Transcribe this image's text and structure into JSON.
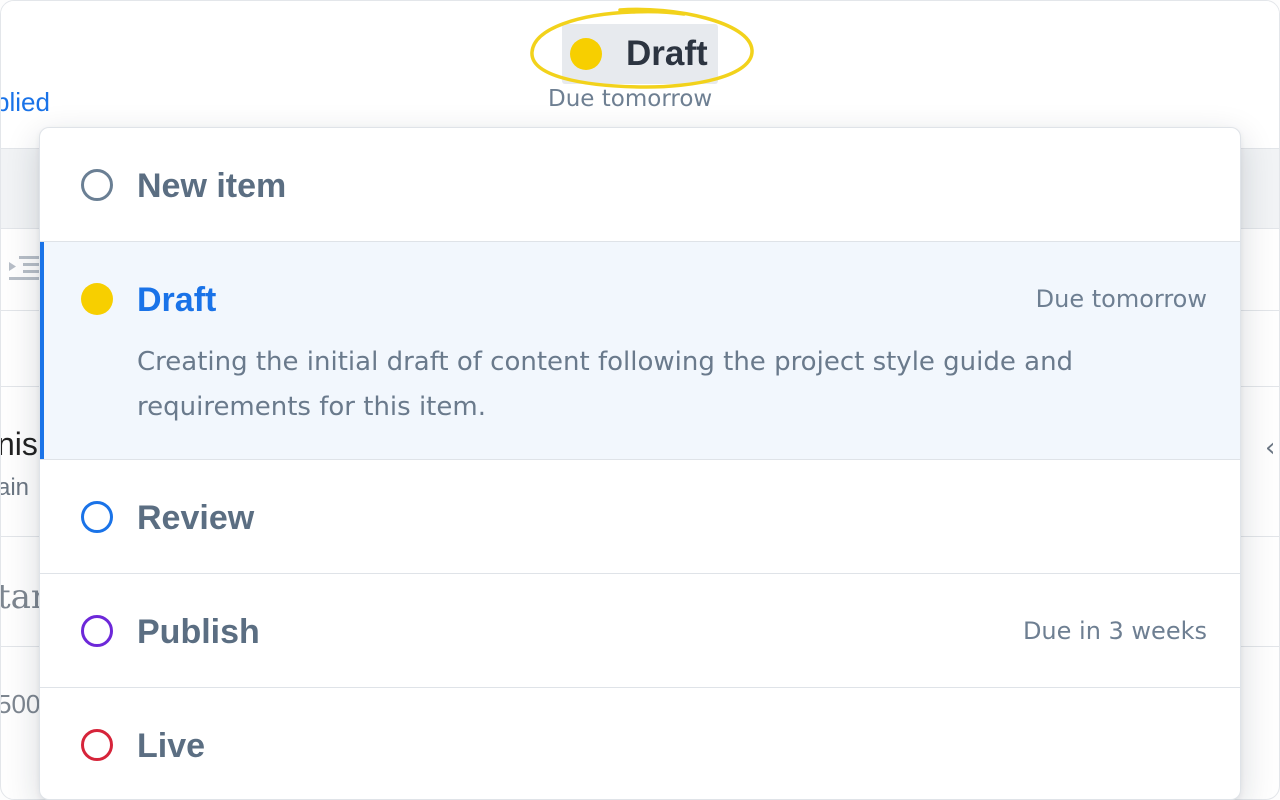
{
  "background": {
    "applied_fragment": "plied",
    "frag_1": "nis",
    "frag_2": "ain",
    "frag_3": "tar",
    "frag_4": "500"
  },
  "trigger": {
    "label": "Draft",
    "subtext": "Due tomorrow",
    "dot_color": "#f7cf00",
    "highlight_color": "#f2d21b"
  },
  "dropdown": {
    "options": [
      {
        "label": "New item",
        "due": "",
        "circle_color": "#6a7f94"
      },
      {
        "label": "Draft",
        "due": "Due tomorrow",
        "description": "Creating the initial draft of content following the project style guide and requirements for this item.",
        "circle_color": "#f7cf00",
        "selected": true
      },
      {
        "label": "Review",
        "due": "",
        "circle_color": "#1a73e8"
      },
      {
        "label": "Publish",
        "due": "Due in 3 weeks",
        "circle_color": "#6d28d9"
      },
      {
        "label": "Live",
        "due": "",
        "circle_color": "#d6243a"
      }
    ]
  },
  "colors": {
    "accent": "#1a73e8",
    "selected_bg": "#f2f7fd",
    "muted_text": "#6e7f92"
  },
  "icons": [
    "indent-icon",
    "chevron-left-icon"
  ]
}
